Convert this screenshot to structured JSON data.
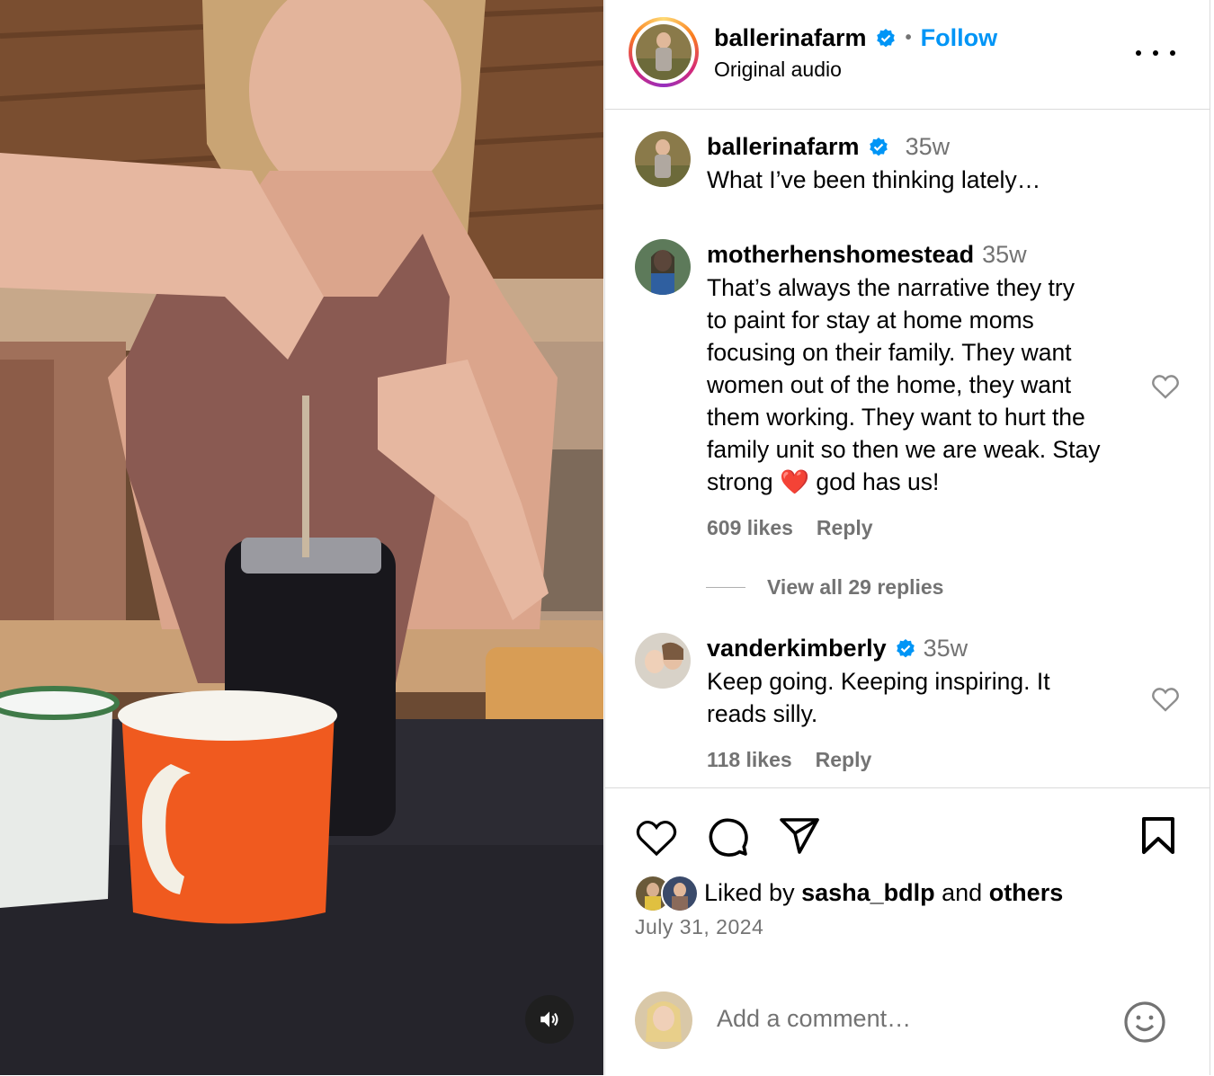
{
  "post": {
    "username": "ballerinafarm",
    "follow_label": "Follow",
    "separator": "•",
    "audio": "Original audio",
    "more_label": "More options"
  },
  "comments": [
    {
      "username": "ballerinafarm",
      "time": "35w",
      "text": "What I’ve been thinking lately…",
      "verified": true
    },
    {
      "username": "motherhenshomestead",
      "time": "35w",
      "text_lines": [
        "That’s always the narrative they try",
        "to paint for stay at home moms",
        "focusing on their family. They want",
        "women out of the home, they want",
        "them working. They want to hurt the",
        "family unit so then we are weak. Stay",
        "strong ❤️ god has us!"
      ],
      "likes": "609 likes",
      "reply_label": "Reply",
      "view_replies": "View all 29 replies"
    },
    {
      "username": "vanderkimberly",
      "time": "35w",
      "verified": true,
      "text_lines": [
        "Keep going. Keeping inspiring. It",
        "reads silly."
      ],
      "likes": "118 likes",
      "reply_label": "Reply"
    }
  ],
  "footer": {
    "liked_prefix": "Liked by ",
    "liked_user": "sasha_bdlp",
    "liked_and": " and ",
    "liked_others": "others",
    "date": "July 31, 2024",
    "comment_placeholder": "Add a comment…"
  },
  "colors": {
    "accent": "#0095f6",
    "verified": "#0095f6",
    "muted": "#737373",
    "heart_emoji": "#e0245e"
  },
  "icons": [
    "verified-badge-icon",
    "more-icon",
    "heart-icon",
    "comment-icon",
    "share-icon",
    "bookmark-icon",
    "emoji-icon",
    "sound-icon"
  ]
}
